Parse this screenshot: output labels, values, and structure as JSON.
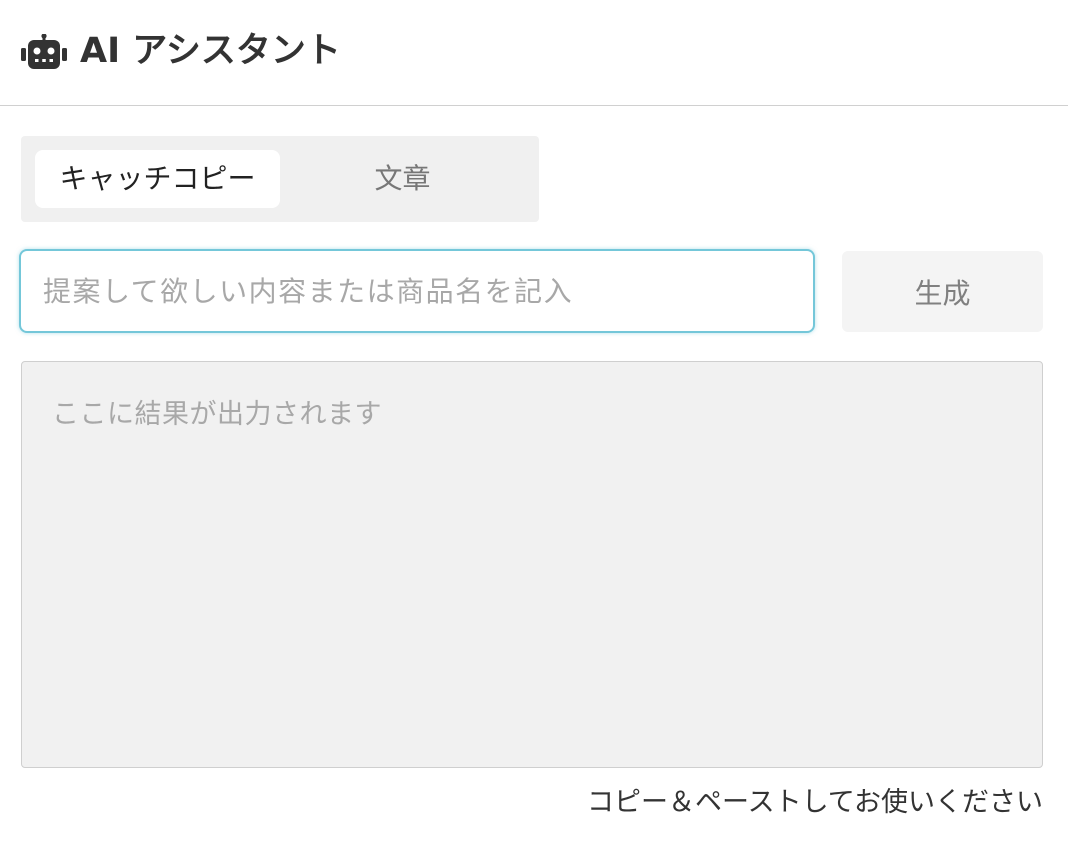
{
  "header": {
    "icon": "robot-icon",
    "title": "AI アシスタント"
  },
  "tabs": [
    {
      "label": "キャッチコピー",
      "selected": true
    },
    {
      "label": "文章",
      "selected": false
    }
  ],
  "prompt": {
    "value": "",
    "placeholder": "提案して欲しい内容または商品名を記入"
  },
  "generate_button": {
    "label": "生成"
  },
  "result": {
    "value": "",
    "placeholder": "ここに結果が出力されます"
  },
  "hint": "コピー＆ペーストしてお使いください",
  "colors": {
    "input_focus_border": "#74c7d9",
    "tab_group_bg": "#f0f0f0",
    "result_bg": "#f1f1f1"
  }
}
